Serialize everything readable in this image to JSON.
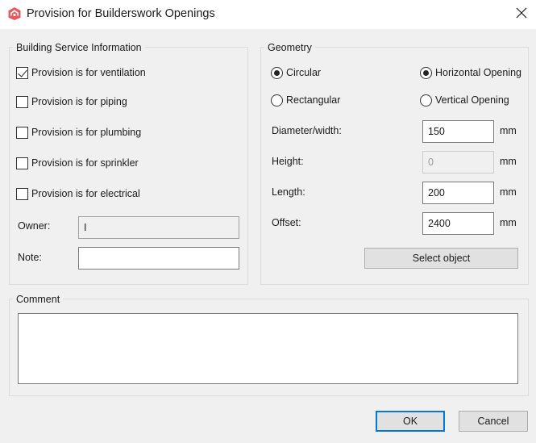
{
  "window": {
    "title": "Provision for Builderswork Openings",
    "close_icon": "close-icon",
    "app_icon": "house-logo-icon",
    "accent_color": "#e8585c"
  },
  "service_info": {
    "legend": "Building Service Information",
    "checkboxes": [
      {
        "label": "Provision is for ventilation",
        "checked": true
      },
      {
        "label": "Provision is for piping",
        "checked": false
      },
      {
        "label": "Provision is for plumbing",
        "checked": false
      },
      {
        "label": "Provision is for sprinkler",
        "checked": false
      },
      {
        "label": "Provision is for electrical",
        "checked": false
      }
    ],
    "owner_label": "Owner:",
    "owner_value": "I",
    "note_label": "Note:",
    "note_value": ""
  },
  "geometry": {
    "legend": "Geometry",
    "shape_options": [
      {
        "label": "Circular",
        "selected": true
      },
      {
        "label": "Rectangular",
        "selected": false
      }
    ],
    "orientation_options": [
      {
        "label": "Horizontal Opening",
        "selected": true
      },
      {
        "label": "Vertical Opening",
        "selected": false
      }
    ],
    "fields": [
      {
        "label": "Diameter/width:",
        "value": "150",
        "unit": "mm",
        "enabled": true
      },
      {
        "label": "Height:",
        "value": "0",
        "unit": "mm",
        "enabled": false
      },
      {
        "label": "Length:",
        "value": "200",
        "unit": "mm",
        "enabled": true
      },
      {
        "label": "Offset:",
        "value": "2400",
        "unit": "mm",
        "enabled": true
      }
    ],
    "select_object_label": "Select object"
  },
  "comment": {
    "legend": "Comment",
    "value": ""
  },
  "footer": {
    "ok_label": "OK",
    "cancel_label": "Cancel",
    "default_button_color": "#0078d7"
  }
}
